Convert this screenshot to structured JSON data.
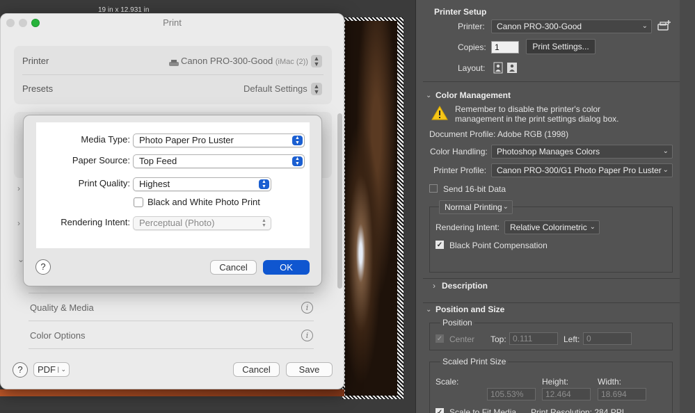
{
  "canvas": {
    "dimensions": "19 in x 12.931 in"
  },
  "print_dialog": {
    "title": "Print",
    "printer_label": "Printer",
    "printer_value": "Canon PRO-300-Good",
    "printer_host": "(iMac (2))",
    "presets_label": "Presets",
    "presets_value": "Default Settings",
    "items": [
      {
        "label": "Quality & Media"
      },
      {
        "label": "Color Options"
      }
    ],
    "help_label": "?",
    "pdf_label": "PDF",
    "cancel_label": "Cancel",
    "save_label": "Save"
  },
  "media_sheet": {
    "media_type_label": "Media Type:",
    "media_type_value": "Photo Paper Pro Luster",
    "paper_source_label": "Paper Source:",
    "paper_source_value": "Top Feed",
    "print_quality_label": "Print Quality:",
    "print_quality_value": "Highest",
    "bw_label": "Black and White Photo Print",
    "bw_checked": false,
    "rendering_intent_label": "Rendering Intent:",
    "rendering_intent_value": "Perceptual (Photo)",
    "help_label": "?",
    "cancel_label": "Cancel",
    "ok_label": "OK"
  },
  "ps_panel": {
    "printer_setup": {
      "heading": "Printer Setup",
      "printer_label": "Printer:",
      "printer_value": "Canon PRO-300-Good",
      "copies_label": "Copies:",
      "copies_value": "1",
      "print_settings_label": "Print Settings...",
      "layout_label": "Layout:"
    },
    "color_management": {
      "heading": "Color Management",
      "warning": "Remember to disable the printer's color management in the print settings dialog box.",
      "document_profile": "Document Profile: Adobe RGB (1998)",
      "color_handling_label": "Color Handling:",
      "color_handling_value": "Photoshop Manages Colors",
      "printer_profile_label": "Printer Profile:",
      "printer_profile_value": "Canon PRO-300/G1 Photo Paper Pro Luster",
      "send16_label": "Send 16-bit Data",
      "send16_checked": false,
      "normal_printing_value": "Normal Printing",
      "rendering_intent_label": "Rendering Intent:",
      "rendering_intent_value": "Relative Colorimetric",
      "bpc_label": "Black Point Compensation",
      "bpc_checked": true
    },
    "description": {
      "heading": "Description"
    },
    "position_size": {
      "heading": "Position and Size",
      "position_label": "Position",
      "center_label": "Center",
      "top_label": "Top:",
      "top_value": "0.111",
      "left_label": "Left:",
      "left_value": "0",
      "scaled_label": "Scaled Print Size",
      "scale_label": "Scale:",
      "scale_value": "105.53%",
      "height_label": "Height:",
      "height_value": "12.464",
      "width_label": "Width:",
      "width_value": "18.694",
      "fit_label": "Scale to Fit Media",
      "resolution_label": "Print Resolution: 284 PPI"
    }
  },
  "colors": {
    "accent_blue": "#0f56d0",
    "popup_blue": "#1b5fd1",
    "ps_panel": "#535353",
    "warning_yellow": "#f5c518"
  }
}
